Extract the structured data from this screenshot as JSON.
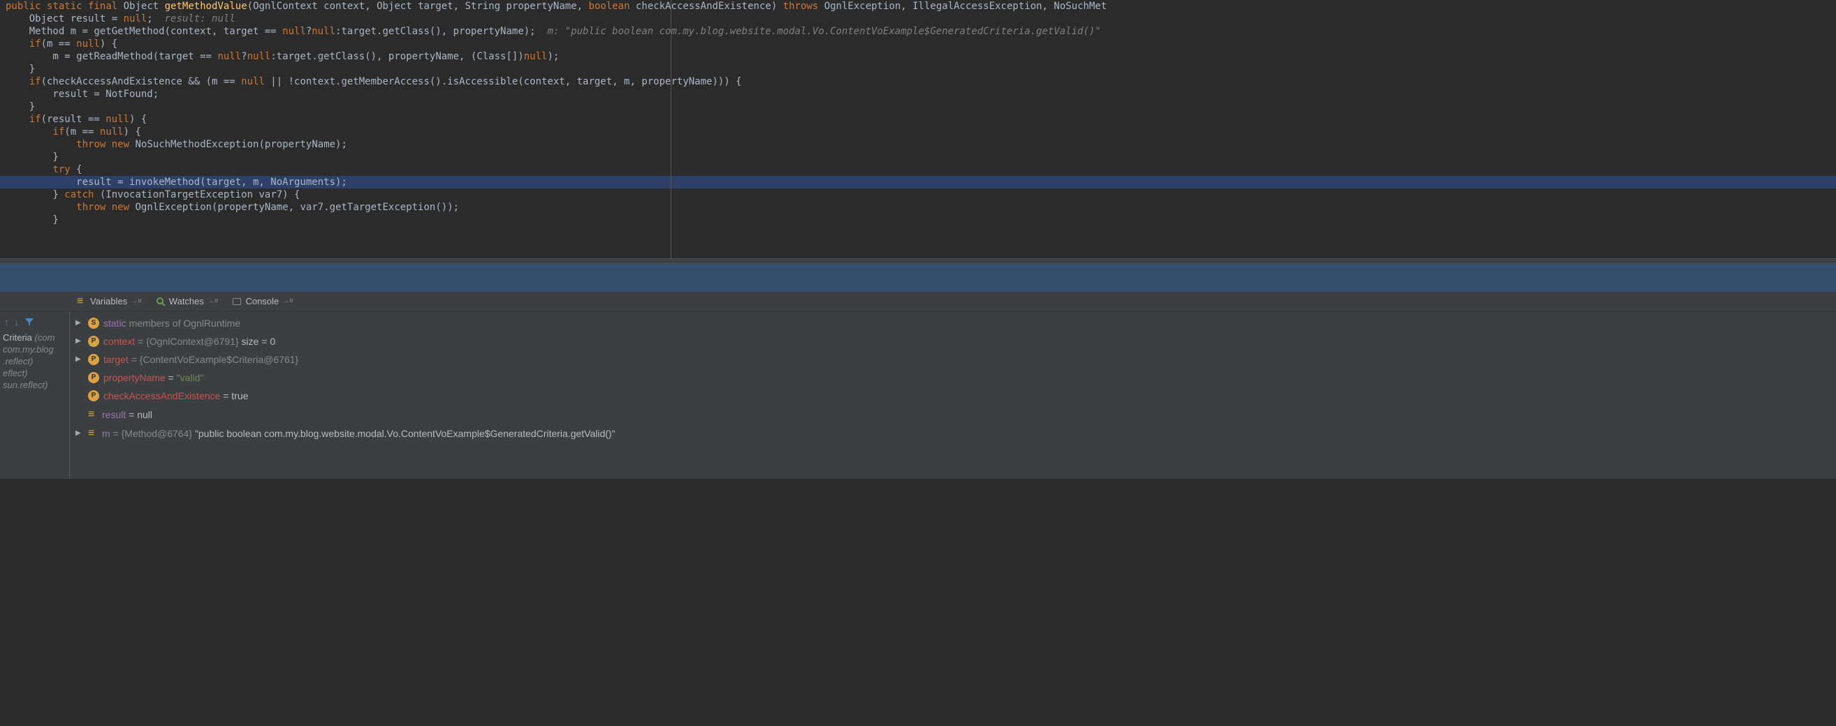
{
  "code": {
    "line1": {
      "pre": "",
      "kw1": "public",
      "kw2": "static",
      "kw3": "final",
      "ret": " Object ",
      "name": "getMethodValue",
      "params_a": "(OgnlContext context, Object target, String propertyName, ",
      "kw4": "boolean",
      "params_b": " checkAccessAndExistence) ",
      "kw5": "throws",
      "throws": " OgnlException, IllegalAccessException, NoSuchMet"
    },
    "line2": {
      "text": "    Object result = ",
      "kw": "null",
      "semi": ";  ",
      "comment": "result: null"
    },
    "line3": {
      "text": "    Method m = getGetMethod(context, target == ",
      "kw1": "null",
      "q": "?",
      "kw2": "null",
      "rest": ":target.getClass(), propertyName);  ",
      "comment": "m: \"public boolean com.my.blog.website.modal.Vo.ContentVoExample$GeneratedCriteria.getValid()\""
    },
    "line4": {
      "pre": "    ",
      "kw": "if",
      "rest": "(m == ",
      "kw2": "null",
      "rest2": ") {"
    },
    "line5": {
      "text": "        m = getReadMethod(target == ",
      "kw1": "null",
      "q": "?",
      "kw2": "null",
      "rest": ":target.getClass(), propertyName, (Class[])",
      "kw3": "null",
      "rest2": ");"
    },
    "line6": "    }",
    "line7": "",
    "line8": {
      "pre": "    ",
      "kw": "if",
      "rest": "(checkAccessAndExistence && (m == ",
      "kw2": "null",
      "rest2": " || !context.getMemberAccess().isAccessible(context, target, m, propertyName))) {"
    },
    "line9": "        result = NotFound;",
    "line10": "    }",
    "line11": "",
    "line12": {
      "pre": "    ",
      "kw": "if",
      "rest": "(result == ",
      "kw2": "null",
      "rest2": ") {"
    },
    "line13": {
      "pre": "        ",
      "kw": "if",
      "rest": "(m == ",
      "kw2": "null",
      "rest2": ") {"
    },
    "line14": {
      "pre": "            ",
      "kw1": "throw",
      "kw2": "new",
      "rest": " NoSuchMethodException(propertyName);"
    },
    "line15": "        }",
    "line16": "",
    "line17": {
      "pre": "        ",
      "kw": "try",
      "rest": " {"
    },
    "line18": "            result = invokeMethod(target, m, NoArguments);",
    "line19": {
      "pre": "        } ",
      "kw": "catch",
      "rest": " (InvocationTargetException var7) {"
    },
    "line20": {
      "pre": "            ",
      "kw1": "throw",
      "kw2": "new",
      "rest": " OgnlException(propertyName, var7.getTargetException());"
    },
    "line21": "        }"
  },
  "tabs": {
    "variables": "Variables",
    "watches": "Watches",
    "console": "Console"
  },
  "frames": {
    "f0": "Criteria",
    "f0_pkg": " (com",
    "f1": "com.my.blog",
    "f2": ".reflect)",
    "f3": "eflect)",
    "f4": "sun.reflect)"
  },
  "vars": {
    "static_label": "static",
    "static_rest": " members of OgnlRuntime",
    "context_name": "context",
    "context_val": " = {OgnlContext@6791}",
    "context_extra": "  size = 0",
    "target_name": "target",
    "target_val": " = {ContentVoExample$Criteria@6761}",
    "propertyName_name": "propertyName",
    "propertyName_val": " = ",
    "propertyName_str": "\"valid\"",
    "check_name": "checkAccessAndExistence",
    "check_val": " = true",
    "result_name": "result",
    "result_val": " = null",
    "m_name": "m",
    "m_val": " = {Method@6764} ",
    "m_str": "\"public boolean com.my.blog.website.modal.Vo.ContentVoExample$GeneratedCriteria.getValid()\""
  }
}
